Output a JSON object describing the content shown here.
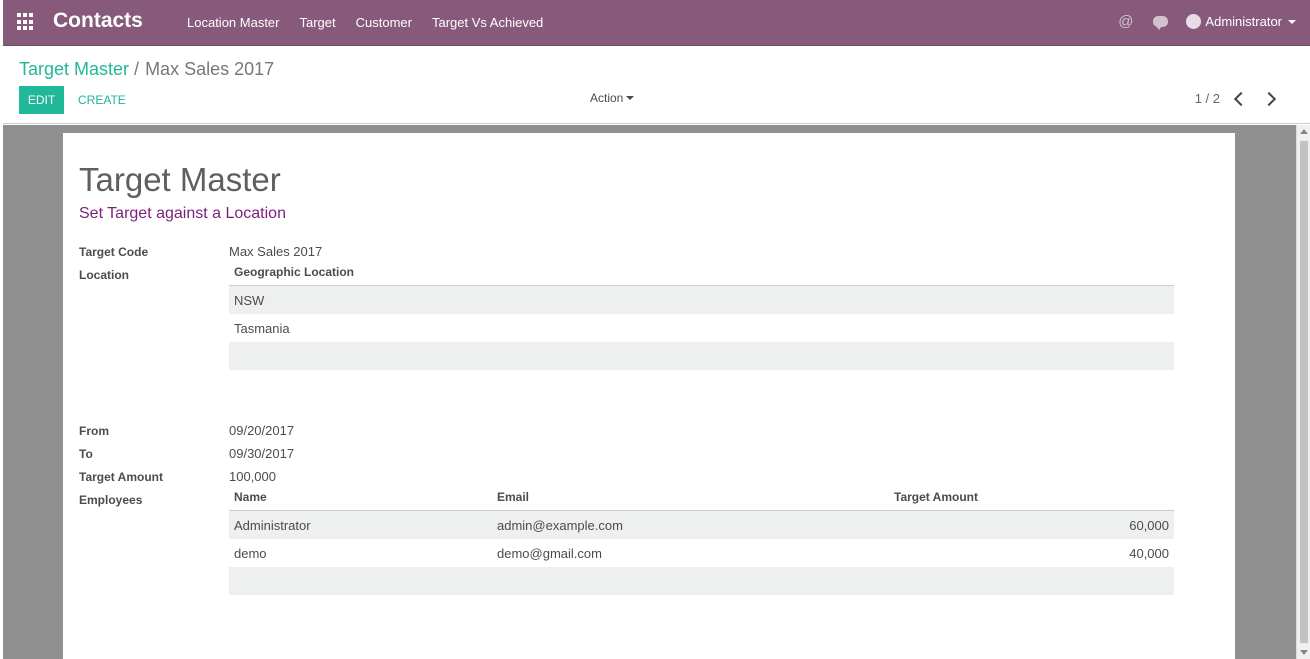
{
  "navbar": {
    "app_title": "Contacts",
    "menu": [
      "Location Master",
      "Target",
      "Customer",
      "Target Vs Achieved"
    ],
    "user": "Administrator"
  },
  "breadcrumb": {
    "parent": "Target Master",
    "separator": "/",
    "current": "Max Sales 2017"
  },
  "buttons": {
    "edit": "EDIT",
    "create": "CREATE",
    "action": "Action"
  },
  "pager": "1 / 2",
  "form": {
    "title": "Target Master",
    "subtitle": "Set Target against a Location",
    "target_code_label": "Target Code",
    "target_code": "Max Sales 2017",
    "location_label": "Location",
    "location_header": "Geographic Location",
    "locations": [
      "NSW",
      "Tasmania"
    ],
    "from_label": "From",
    "from": "09/20/2017",
    "to_label": "To",
    "to": "09/30/2017",
    "target_amount_label": "Target Amount",
    "target_amount": "100,000",
    "employees_label": "Employees",
    "employee_headers": {
      "name": "Name",
      "email": "Email",
      "amount": "Target Amount"
    },
    "employees": [
      {
        "name": "Administrator",
        "email": "admin@example.com",
        "amount": "60,000"
      },
      {
        "name": "demo",
        "email": "demo@gmail.com",
        "amount": "40,000"
      }
    ]
  }
}
